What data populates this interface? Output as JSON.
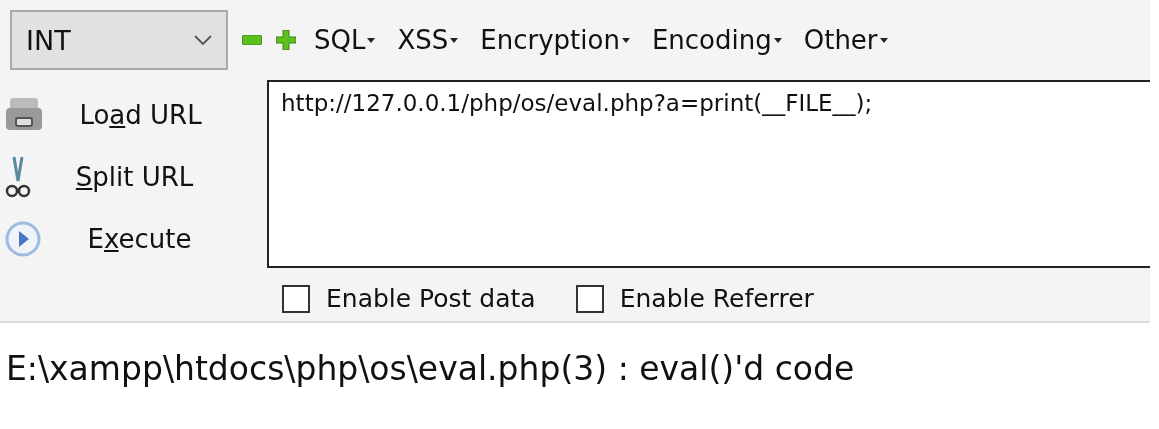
{
  "toolbar": {
    "select": {
      "value": "INT"
    },
    "menus": [
      {
        "label": "SQL"
      },
      {
        "label": "XSS"
      },
      {
        "label": "Encryption"
      },
      {
        "label": "Encoding"
      },
      {
        "label": "Other"
      }
    ]
  },
  "actions": [
    {
      "kind": "load",
      "label": {
        "before": "Lo",
        "access_key": "a",
        "after": "d URL"
      }
    },
    {
      "kind": "split",
      "label": {
        "access_key": "S",
        "after": "plit URL"
      }
    },
    {
      "kind": "execute",
      "label": {
        "before": "E",
        "access_key": "x",
        "after": "ecute"
      }
    }
  ],
  "url_field": {
    "value": "http://127.0.0.1/php/os/eval.php?a=print(__FILE__);"
  },
  "options": [
    {
      "label": "Enable Post data",
      "checked": false
    },
    {
      "label": "Enable Referrer",
      "checked": false
    }
  ],
  "output": "E:\\xampp\\htdocs\\php\\os\\eval.php(3) : eval()'d code"
}
